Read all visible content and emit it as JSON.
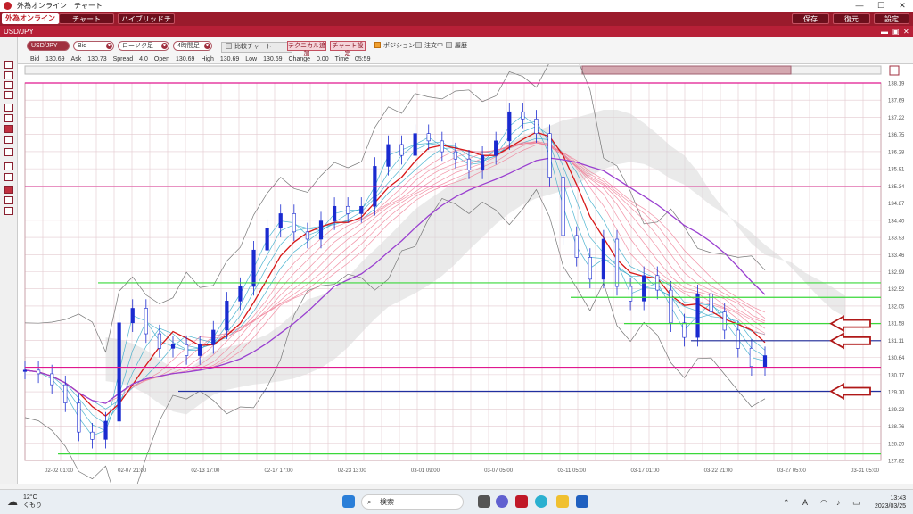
{
  "window": {
    "title": "外為オンライン　チャート",
    "minimize": "—",
    "maximize": "☐",
    "close": "✕"
  },
  "menubar": {
    "logo": "外為オンライン",
    "chart_label": "チャート",
    "hybrid_label": "ハイブリッドチャート",
    "save_label": "保存",
    "restore_label": "復元",
    "settings_label": "設定"
  },
  "symbol_bar": {
    "symbol": "USD/JPY"
  },
  "toolbar": {
    "pair_select": "USD/JPY",
    "bid_select": "Bid",
    "candle_select": "ローソク足",
    "timeframe_select": "4時間足",
    "compare_label": "比較チャート",
    "technical_label": "テクニカル追加",
    "chart_settings_label": "チャート設定",
    "position_label": "ポジション",
    "order_label": "注文中",
    "history_label": "履歴",
    "quote_line": "Bid　130.69　Ask　130.73　Spread　4.0　Open　130.69　High　130.69　Low　130.69　Change　0.00　Time　05:59"
  },
  "chart_data": {
    "type": "line",
    "symbol": "USD/JPY",
    "ylim": [
      127.82,
      138.19
    ],
    "yticks": [
      "138.19",
      "137.69",
      "137.22",
      "136.75",
      "136.28",
      "135.81",
      "135.34",
      "134.87",
      "134.40",
      "133.93",
      "133.46",
      "132.99",
      "132.52",
      "132.05",
      "131.58",
      "131.11",
      "130.64",
      "130.17",
      "129.70",
      "129.23",
      "128.76",
      "128.29",
      "127.82"
    ],
    "xticks": [
      "02-02 01:00",
      "02-07 21:00",
      "02-13 17:00",
      "02-17 17:00",
      "02-23 13:00",
      "03-01 09:00",
      "03-07 05:00",
      "03-11 05:00",
      "03-17 01:00",
      "03-22 21:00",
      "03-27 05:00",
      "03-31 05:00"
    ],
    "price_path": [
      130.3,
      130.2,
      129.9,
      129.4,
      128.6,
      128.4,
      128.9,
      131.6,
      132.0,
      131.3,
      130.9,
      131.0,
      130.7,
      131.0,
      131.4,
      132.2,
      132.6,
      133.6,
      134.2,
      134.6,
      134.1,
      133.9,
      134.4,
      134.8,
      134.6,
      134.8,
      135.9,
      136.5,
      136.2,
      136.8,
      136.6,
      136.3,
      136.1,
      135.8,
      136.2,
      136.6,
      137.4,
      137.2,
      136.8,
      135.6,
      134.0,
      133.4,
      132.8,
      133.9,
      132.6,
      132.2,
      132.9,
      132.5,
      131.6,
      131.2,
      132.4,
      131.9,
      131.4,
      130.9,
      130.4,
      130.7
    ],
    "horizontal_lines": [
      {
        "price": 138.19,
        "color": "#e0188f"
      },
      {
        "price": 135.34,
        "color": "#e0188f"
      },
      {
        "price": 130.38,
        "color": "#e0188f"
      },
      {
        "price": 132.7,
        "color": "#3ad83a"
      },
      {
        "price": 132.3,
        "color": "#3ad83a"
      },
      {
        "price": 131.58,
        "color": "#3ad83a"
      },
      {
        "price": 128.0,
        "color": "#3ad83a"
      },
      {
        "price": 131.11,
        "color": "#2030a0"
      },
      {
        "price": 129.72,
        "color": "#2030a0"
      }
    ],
    "arrow_prices": [
      131.58,
      131.11,
      129.72
    ],
    "colors": {
      "up": "#1a2ad0",
      "down": "#1a2ad0",
      "ma_fast": "#d81818",
      "ma_slow": "#9a40d0",
      "ribbon_teal": "#30a8c8",
      "ribbon_pink": "#f08098",
      "band": "#777777",
      "cloud": "#d8d8d8",
      "arrow": "#b01818"
    },
    "grid": true
  },
  "taskbar": {
    "temperature": "12°C",
    "weather": "くもり",
    "search_placeholder": "検索",
    "ime": "A",
    "time": "13:43",
    "date": "2023/03/25"
  }
}
